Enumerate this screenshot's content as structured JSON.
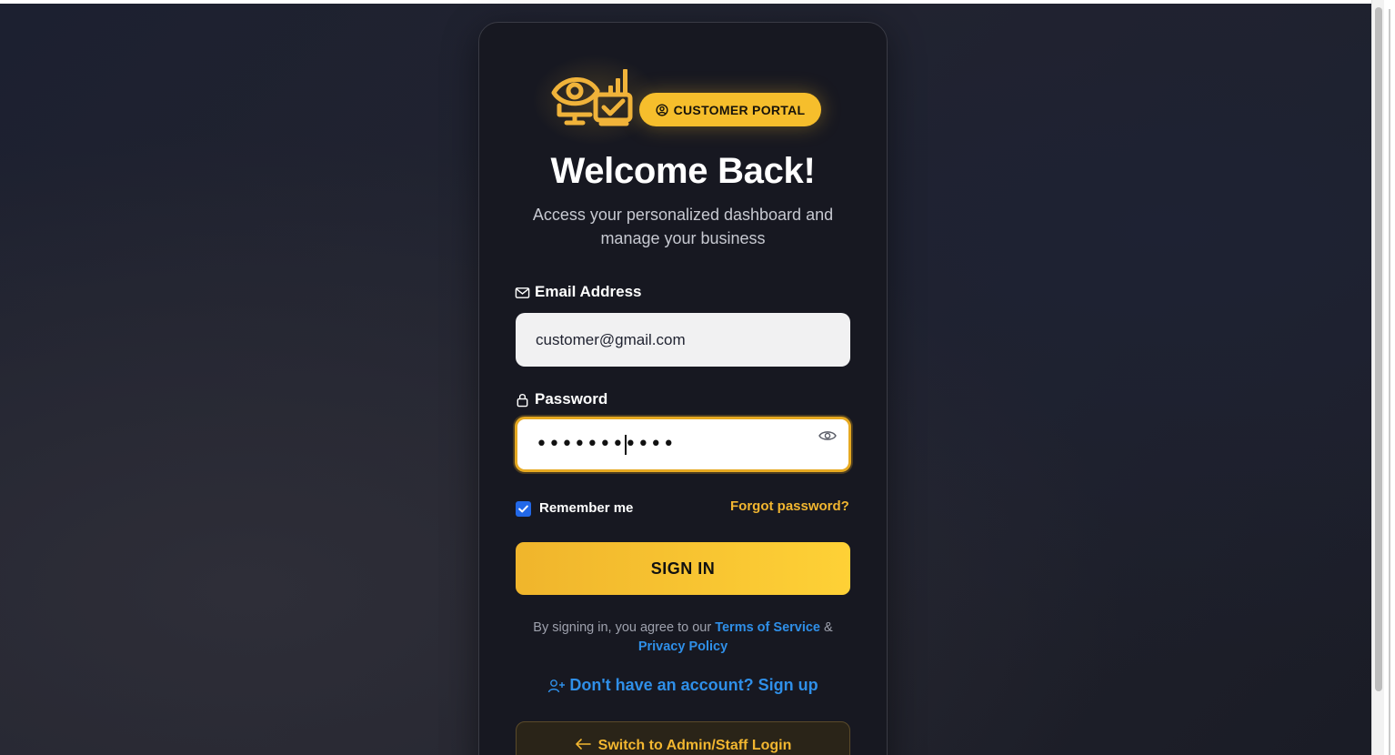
{
  "badge": {
    "label": "CUSTOMER PORTAL",
    "icon": "user-circle-icon"
  },
  "header": {
    "title": "Welcome Back!",
    "subtitle": "Access your personalized dashboard and manage your business"
  },
  "form": {
    "email": {
      "label": "Email Address",
      "icon": "mail-icon",
      "value": "customer@gmail.com"
    },
    "password": {
      "label": "Password",
      "icon": "lock-icon",
      "value": "•••••••••••",
      "toggle_icon": "eye-icon"
    },
    "remember": {
      "label": "Remember me",
      "checked": true
    },
    "forgot_label": "Forgot password?",
    "submit_label": "SIGN IN"
  },
  "legal": {
    "prefix": "By signing in, you agree to our ",
    "terms_label": "Terms of Service",
    "joiner": " & ",
    "privacy_label": "Privacy Policy"
  },
  "signup_label": "Don't have an account? Sign up",
  "switch_label": "Switch to Admin/Staff Login",
  "colors": {
    "accent": "#f6be2c",
    "link": "#2f8fe8",
    "card": "#171821",
    "checkbox": "#2268e8"
  }
}
